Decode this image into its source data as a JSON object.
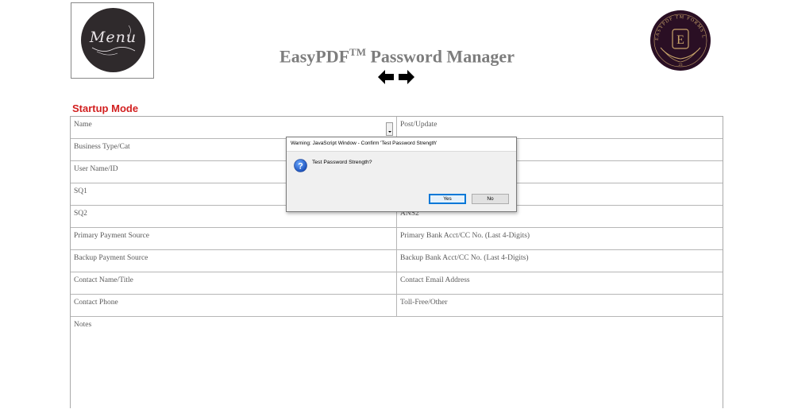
{
  "header": {
    "menu_text": "Menu",
    "title_main": "EasyPDF",
    "title_tm": "TM",
    "title_rest": " Password Manager",
    "logo_letter": "E",
    "logo_ring_text": "EASYPDF TM FORMS LLC",
    "logo_number": "23"
  },
  "section": {
    "label": "Startup Mode"
  },
  "form": {
    "rows": [
      {
        "left": "Name",
        "right": "Post/Update"
      },
      {
        "left": "Business Type/Cat",
        "right": ""
      },
      {
        "left": "User Name/ID",
        "right": ""
      },
      {
        "left": "SQ1",
        "right": ""
      },
      {
        "left": "SQ2",
        "right": "ANS2"
      },
      {
        "left": "Primary Payment Source",
        "right": "Primary Bank Acct/CC No. (Last 4-Digits)"
      },
      {
        "left": "Backup Payment Source",
        "right": "Backup Bank Acct/CC No. (Last 4-Digits)"
      },
      {
        "left": "Contact Name/Title",
        "right": "Contact Email Address"
      },
      {
        "left": "Contact Phone",
        "right": "Toll-Free/Other"
      }
    ],
    "notes_label": "Notes"
  },
  "dialog": {
    "title": "Warning: JavaScript Window - Confirm 'Test Password Strength'",
    "message": "Test Password Strength?",
    "yes_label": "Yes",
    "no_label": "No",
    "icon": "question-icon"
  },
  "colors": {
    "title": "#7d7d7d",
    "section_label": "#d21f1f",
    "logo_bg": "#2a0f24",
    "logo_gold": "#c9a56a",
    "menu_bg": "#2f2a2c",
    "dialog_primary_border": "#0078d7"
  }
}
